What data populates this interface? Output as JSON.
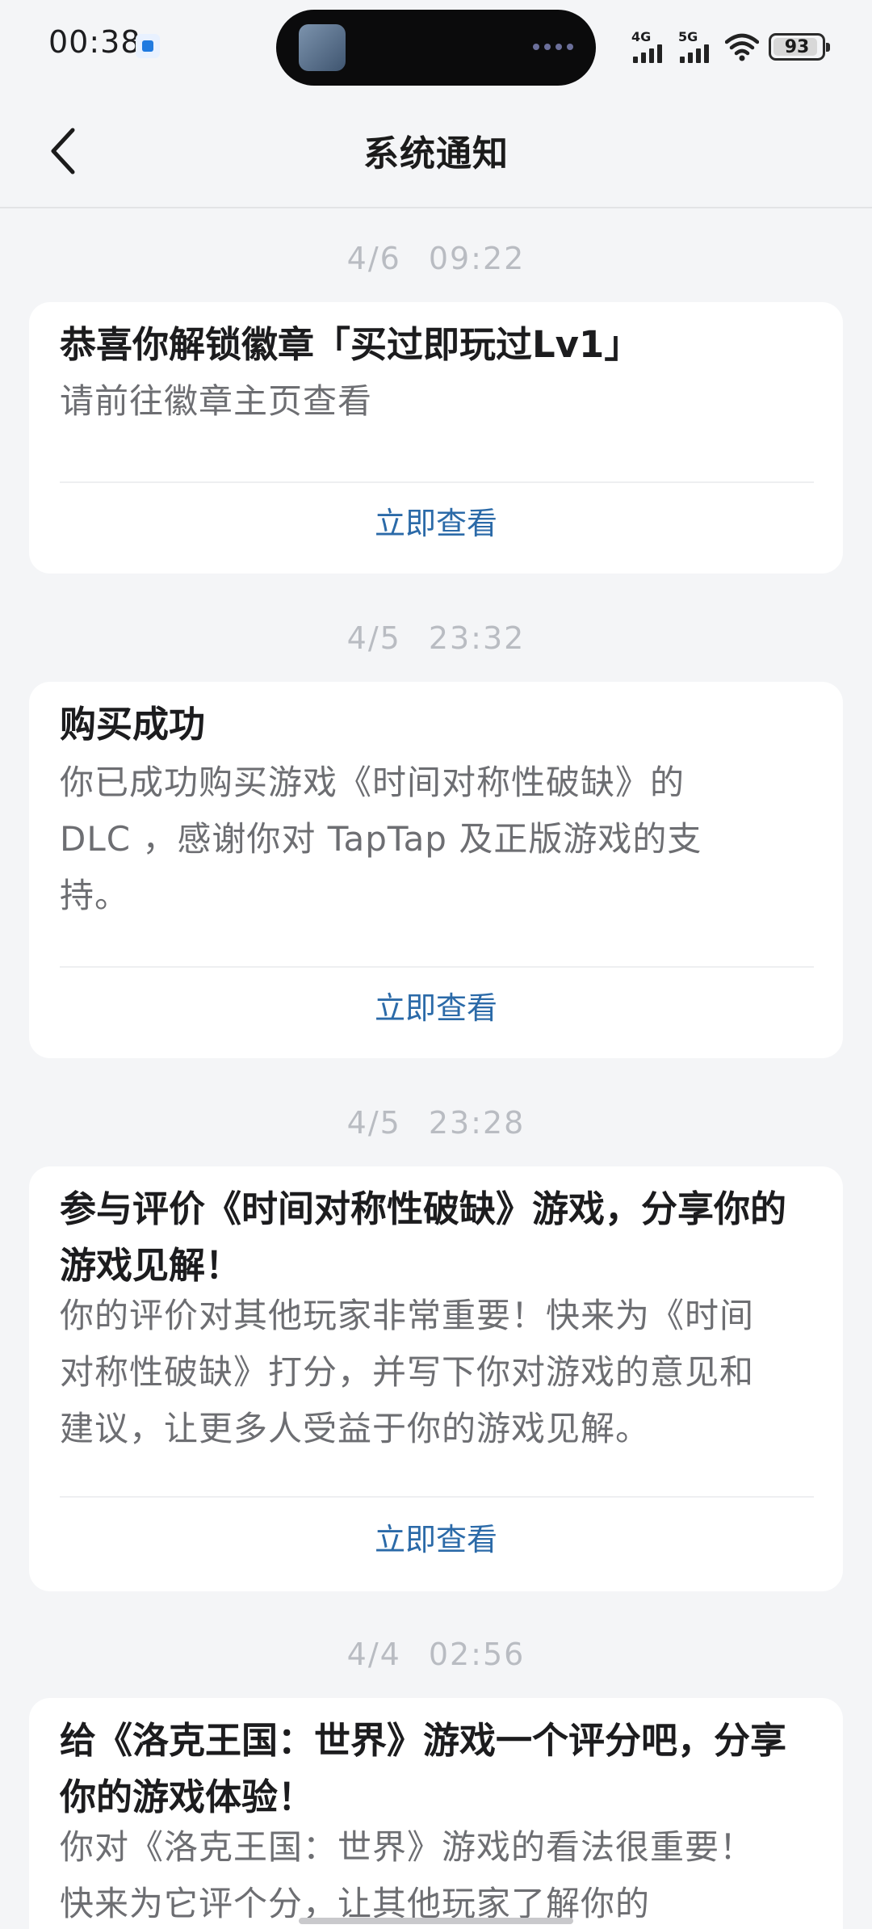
{
  "status_bar": {
    "time": "00:38",
    "network_1": "4G",
    "network_2": "5G",
    "battery": "93",
    "battery_level": 0.93
  },
  "nav": {
    "title": "系统通知"
  },
  "notifications": [
    {
      "date": "4/6",
      "time": "09:22",
      "title": "恭喜你解锁徽章「买过即玩过Lv1」",
      "body": "请前往徽章主页查看",
      "action": "立即查看"
    },
    {
      "date": "4/5",
      "time": "23:32",
      "title": "购买成功",
      "body": "你已成功购买游戏《时间对称性破缺》的DLC ，感谢你对 TapTap 及正版游戏的支持。",
      "action": "立即查看"
    },
    {
      "date": "4/5",
      "time": "23:28",
      "title": "参与评价《时间对称性破缺》游戏，分享你的游戏见解！",
      "body": "你的评价对其他玩家非常重要！快来为《时间对称性破缺》打分，并写下你对游戏的意见和建议，让更多人受益于你的游戏见解。",
      "action": "立即查看"
    },
    {
      "date": "4/4",
      "time": "02:56",
      "title": "给《洛克王国：世界》游戏一个评分吧，分享你的游戏体验！",
      "body": "你对《洛克王国：世界》游戏的看法很重要！快来为它评个分，让其他玩家了解你的"
    }
  ],
  "colors": {
    "background": "#f4f5f7",
    "card": "#ffffff",
    "link": "#2b6aa8",
    "timestamp": "#b9bcc2"
  }
}
